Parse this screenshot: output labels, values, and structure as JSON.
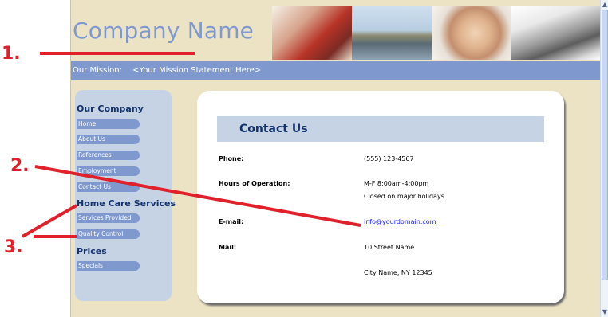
{
  "header": {
    "company_name": "Company Name"
  },
  "mission": {
    "label": "Our Mission:",
    "statement": "<Your Mission Statement Here>"
  },
  "sidebar": {
    "sections": [
      {
        "heading": "Our Company",
        "items": [
          "Home",
          "About Us",
          "References",
          "Employment",
          "Contact Us"
        ]
      },
      {
        "heading": "Home Care Services",
        "items": [
          "Services Provided",
          "Quality Control"
        ]
      },
      {
        "heading": "Prices",
        "items": [
          "Specials"
        ]
      }
    ]
  },
  "contact": {
    "title": "Contact Us",
    "phone_label": "Phone:",
    "phone_value": "(555) 123-4567",
    "hours_label": "Hours of Operation:",
    "hours_value_1": "M-F 8:00am-4:00pm",
    "hours_value_2": "Closed on major holidays.",
    "email_label": "E-mail:",
    "email_value": "info@yourdomain.com",
    "mail_label": "Mail:",
    "mail_value_1": "10 Street Name",
    "mail_value_2": "City Name, NY 12345"
  },
  "annotations": {
    "n1": "1.",
    "n2": "2.",
    "n3": "3.",
    "color": "#e0202a"
  },
  "colors": {
    "background": "#ece3c4",
    "accent": "#7f99cf",
    "heading": "#13336e",
    "panel": "#c6d3e5"
  }
}
